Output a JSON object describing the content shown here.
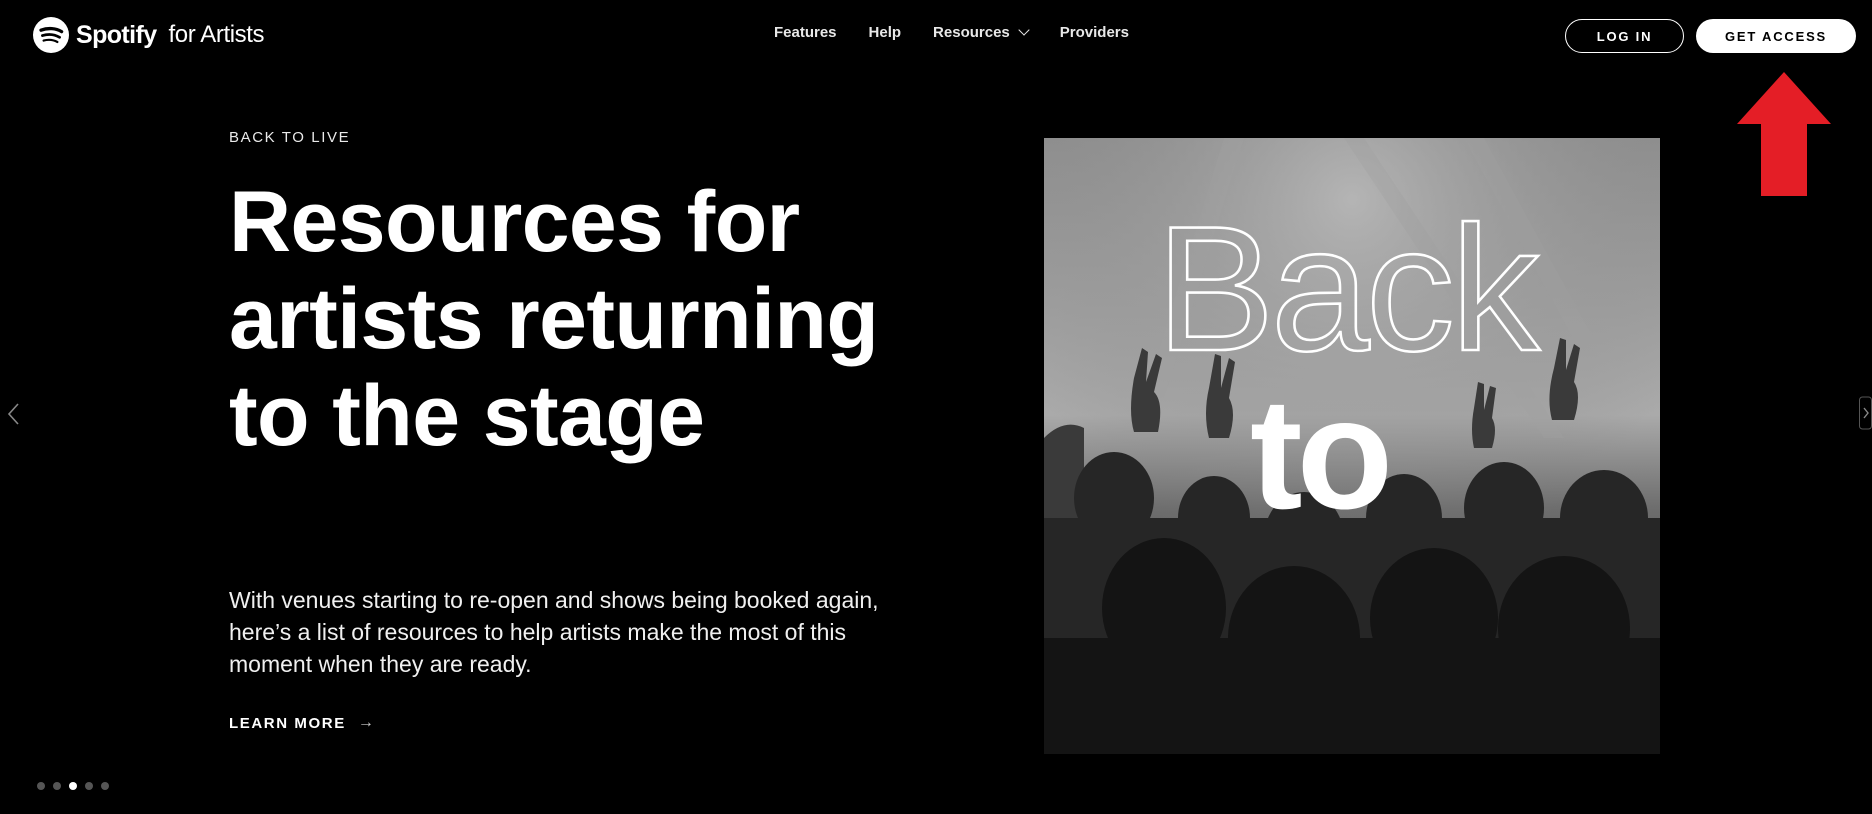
{
  "brand": {
    "name": "Spotify",
    "sub": "for Artists"
  },
  "nav": {
    "features": "Features",
    "help": "Help",
    "resources": "Resources",
    "providers": "Providers"
  },
  "header": {
    "login_label": "LOG IN",
    "access_label": "GET ACCESS"
  },
  "hero": {
    "eyebrow": "BACK TO LIVE",
    "headline": "Resources for artists returning to the stage",
    "description": "With venues starting to re-open and shows being booked again, here’s a list of resources to help artists make the most of this moment when they are ready.",
    "cta": "LEARN MORE",
    "image_text_outline": "Back",
    "image_text_solid": "to"
  },
  "carousel": {
    "slide_count": 5,
    "active_index": 2
  },
  "colors": {
    "background": "#000000",
    "annotation_arrow": "#e41e26"
  },
  "icons": [
    "spotify-logo-icon",
    "chevron-down-icon",
    "arrow-right-icon",
    "chevron-left-icon",
    "chevron-right-icon",
    "annotation-arrow-up-icon"
  ]
}
